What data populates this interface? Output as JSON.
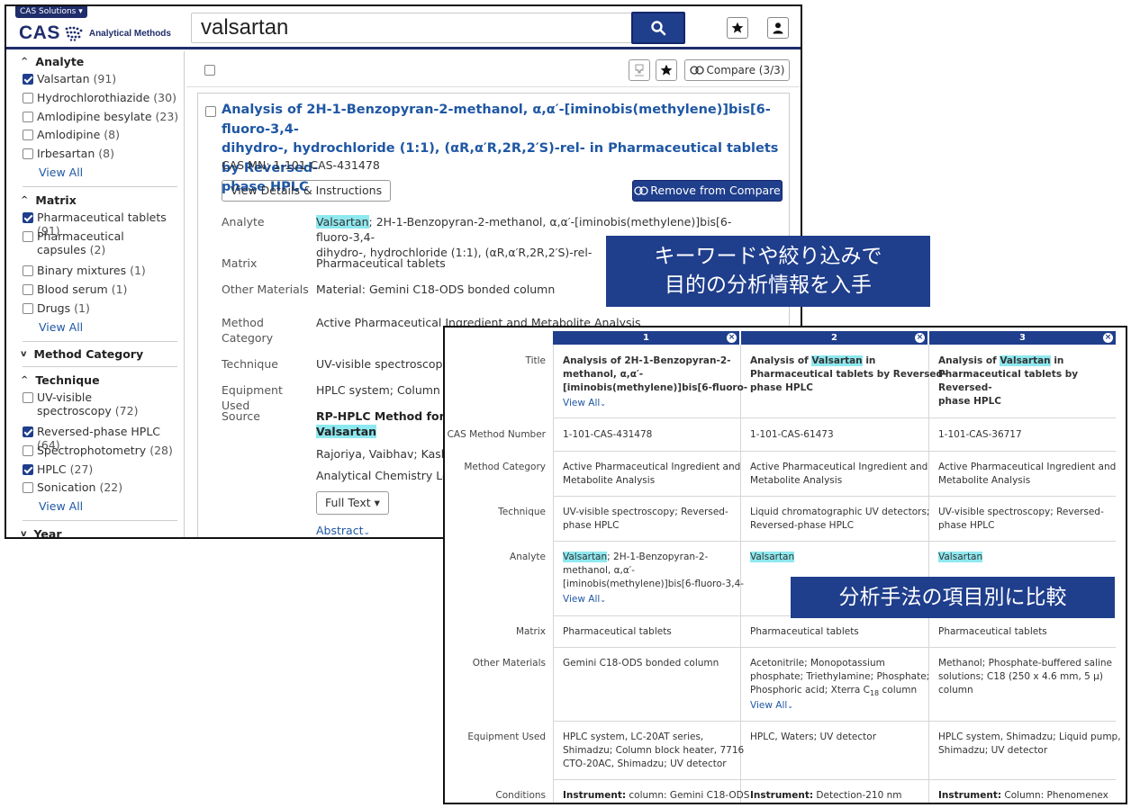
{
  "header": {
    "solutions_label": "CAS Solutions",
    "logo_text": "CAS",
    "product_name": "Analytical Methods",
    "search_value": "valsartan"
  },
  "sidebar": {
    "sections": {
      "analyte": "Analyte",
      "matrix": "Matrix",
      "method_category": "Method Category",
      "technique": "Technique",
      "year": "Year"
    },
    "analyte": [
      {
        "label": "Valsartan",
        "count": "(91)",
        "checked": true
      },
      {
        "label": "Hydrochlorothiazide",
        "count": "(30)",
        "checked": false
      },
      {
        "label": "Amlodipine besylate",
        "count": "(23)",
        "checked": false
      },
      {
        "label": "Amlodipine",
        "count": "(8)",
        "checked": false
      },
      {
        "label": "Irbesartan",
        "count": "(8)",
        "checked": false
      }
    ],
    "matrix": [
      {
        "label": "Pharmaceutical tablets",
        "count": "(91)",
        "checked": true
      },
      {
        "label": "Pharmaceutical capsules",
        "count": "(2)",
        "checked": false
      },
      {
        "label": "Binary mixtures",
        "count": "(1)",
        "checked": false
      },
      {
        "label": "Blood serum",
        "count": "(1)",
        "checked": false
      },
      {
        "label": "Drugs",
        "count": "(1)",
        "checked": false
      }
    ],
    "technique": [
      {
        "label": "UV-visible spectroscopy",
        "count": "(72)",
        "checked": false
      },
      {
        "label": "Reversed-phase HPLC",
        "count": "(64)",
        "checked": true
      },
      {
        "label": "Spectrophotometry",
        "count": "(28)",
        "checked": false
      },
      {
        "label": "HPLC",
        "count": "(27)",
        "checked": true
      },
      {
        "label": "Sonication",
        "count": "(22)",
        "checked": false
      }
    ],
    "view_all": "View All"
  },
  "toolbar": {
    "compare_label": "Compare (3/3)"
  },
  "result": {
    "title_line1": "Analysis of 2H-1-Benzopyran-2-methanol, α,α′-[iminobis(methylene)]bis[6-fluoro-3,4-",
    "title_line2": "dihydro-, hydrochloride (1:1), (αR,α′R,2R,2′S)-rel- in Pharmaceutical tablets by Reversed-",
    "title_line3": "phase HPLC",
    "cas_mn": "CAS MN: 1-101-CAS-431478",
    "view_details_label": "View Details & Instructions",
    "remove_compare_label": "Remove from Compare",
    "labels": {
      "analyte": "Analyte",
      "matrix": "Matrix",
      "other_materials": "Other Materials",
      "method_category": "Method Category",
      "technique": "Technique",
      "equipment": "Equipment Used",
      "source": "Source"
    },
    "analyte_hl": "Valsartan",
    "analyte_rest1": "; 2H-1-Benzopyran-2-methanol, α,α′-[iminobis(methylene)]bis[6-fluoro-3,4-",
    "analyte_rest2": "dihydro-, hydrochloride (1:1), (αR,α′R,2R,2′S)-rel-",
    "matrix": "Pharmaceutical tablets",
    "other_materials": "Material: Gemini C18-ODS bonded column",
    "method_category": "Active Pharmaceutical Ingredient and Metabolite Analysis",
    "technique": "UV-visible spectroscopy; R",
    "equipment": "HPLC system; Column blo",
    "source_title": "RP-HPLC Method for the",
    "source_hl": "Valsartan",
    "authors": "Rajoriya, Vaibhav; Kashaw",
    "journal": "Analytical Chemistry Lette",
    "full_text_label": "Full Text",
    "abstract_label": "Abstract"
  },
  "banners": {
    "top_line1": "キーワードや絞り込みで",
    "top_line2": "目的の分析情報を入手",
    "bottom": "分析手法の項目別に比較"
  },
  "compare": {
    "columns": [
      "1",
      "2",
      "3"
    ],
    "row_labels": {
      "title": "Title",
      "cas_number": "CAS Method Number",
      "method_category": "Method Category",
      "technique": "Technique",
      "analyte": "Analyte",
      "matrix": "Matrix",
      "other_materials": "Other Materials",
      "equipment": "Equipment Used",
      "conditions": "Conditions"
    },
    "view_all": "View All",
    "c1": {
      "title1": "Analysis of 2H-1-Benzopyran-2-",
      "title2": "methanol, α,α′-",
      "title3": "[iminobis(methylene)]bis[6-fluoro-",
      "cas": "1-101-CAS-431478",
      "mc1": "Active Pharmaceutical Ingredient and",
      "mc2": "Metabolite Analysis",
      "tech1": "UV-visible spectroscopy; Reversed-",
      "tech2": "phase HPLC",
      "an_hl": "Valsartan",
      "an1": "; 2H-1-Benzopyran-2-",
      "an2": "methanol, α,α′-",
      "an3": "[iminobis(methylene)]bis[6-fluoro-3,4-",
      "matrix": "Pharmaceutical tablets",
      "om1": "Gemini C18-ODS bonded column",
      "eq1": "HPLC system, LC-20AT series,",
      "eq2": "Shimadzu; Column block heater, 7716",
      "eq3": "CTO-20AC, Shimadzu; UV detector",
      "cond_label": "Instrument:",
      "cond": "column: Gemini C18-ODS"
    },
    "c2": {
      "title_pre": "Analysis of ",
      "title_hl": "Valsartan",
      "title_post": " in",
      "title2": "Pharmaceutical tablets by Reversed-",
      "title3": "phase HPLC",
      "cas": "1-101-CAS-61473",
      "mc1": "Active Pharmaceutical Ingredient and",
      "mc2": "Metabolite Analysis",
      "tech1": "Liquid chromatographic UV detectors;",
      "tech2": "Reversed-phase HPLC",
      "an_hl": "Valsartan",
      "matrix": "Pharmaceutical tablets",
      "om1": "Acetonitrile; Monopotassium",
      "om2": "phosphate; Triethylamine; Phosphate;",
      "om3_pre": "Phosphoric acid; Xterra C",
      "om3_sub": "18",
      "om3_post": " column",
      "eq1": "HPLC, Waters; UV detector",
      "cond_label": "Instrument:",
      "cond": "Detection-210 nm"
    },
    "c3": {
      "title_pre": "Analysis of ",
      "title_hl": "Valsartan",
      "title_post": " in",
      "title2": "Pharmaceutical tablets by Reversed-",
      "title3": "phase HPLC",
      "cas": "1-101-CAS-36717",
      "mc1": "Active Pharmaceutical Ingredient and",
      "mc2": "Metabolite Analysis",
      "tech1": "UV-visible spectroscopy; Reversed-",
      "tech2": "phase HPLC",
      "an_hl": "Valsartan",
      "matrix": "Pharmaceutical tablets",
      "om1": "Methanol; Phosphate-buffered saline",
      "om2": "solutions; C18 (250 x 4.6 mm, 5 μ)",
      "om3": "column",
      "eq1": "HPLC system, Shimadzu; Liquid pump,",
      "eq2": "Shimadzu; UV detector",
      "cond_label": "Instrument:",
      "cond": "Column: Phenomenex"
    }
  },
  "colors": {
    "brand_navy": "#1f3e8c",
    "link_blue": "#1f57a4",
    "highlight": "#8ee8ef"
  }
}
